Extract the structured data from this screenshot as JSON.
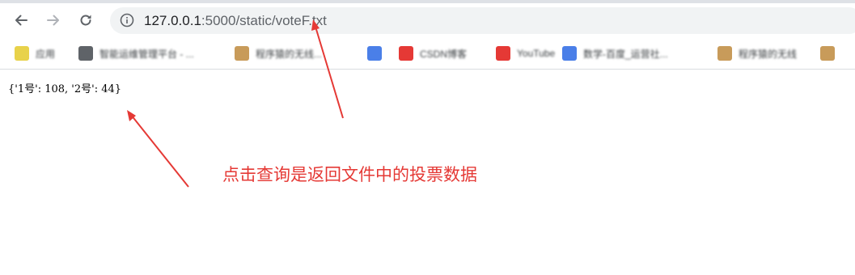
{
  "browser": {
    "url_host": "127.0.0.1",
    "url_rest": ":5000/static/voteF.txt",
    "icons": {
      "back": "arrow-left-icon",
      "forward": "arrow-right-icon",
      "reload": "reload-icon",
      "info": "info-icon"
    }
  },
  "bookmarks": [
    {
      "label": "应用",
      "color": "#e8d24a"
    },
    {
      "label": "智能运维管理平台 - ...",
      "color": "#5f6368"
    },
    {
      "label": "程序猿的无线...",
      "color": "#c89b5a"
    },
    {
      "label": "",
      "color": "#4a7fe8"
    },
    {
      "label": "CSDN博客",
      "color": "#e53935"
    },
    {
      "label": "YouTube",
      "color": "#e53935"
    },
    {
      "label": "数学-百度_运营社...",
      "color": "#4a7fe8"
    },
    {
      "label": "程序猿的无线",
      "color": "#c89b5a"
    },
    {
      "label": "",
      "color": "#c89b5a"
    }
  ],
  "page": {
    "file_text": "{'1号': 108, '2号': 44}"
  },
  "annotation": {
    "note": "点击查询是返回文件中的投票数据",
    "color": "#e53935"
  }
}
